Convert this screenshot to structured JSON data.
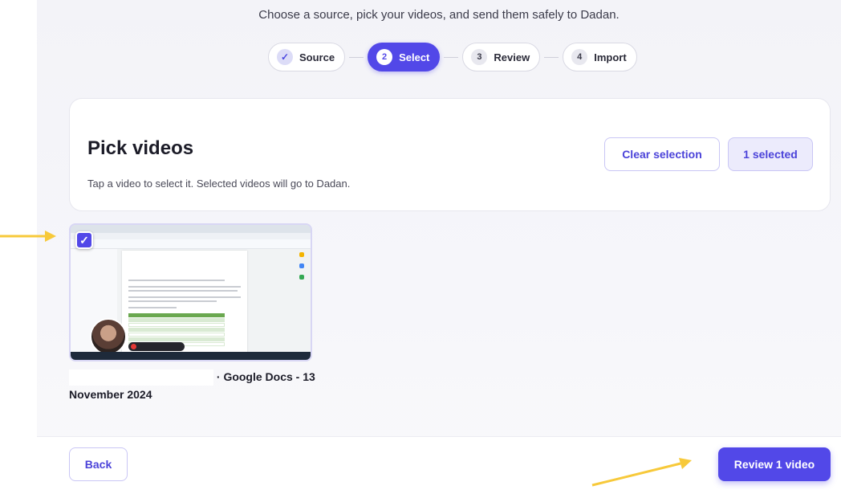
{
  "header": {
    "subtitle": "Choose a source, pick your videos, and send them safely to Dadan."
  },
  "stepper": {
    "steps": [
      {
        "number": "✓",
        "label": "Source",
        "state": "done"
      },
      {
        "number": "2",
        "label": "Select",
        "state": "active"
      },
      {
        "number": "3",
        "label": "Review",
        "state": "upcoming"
      },
      {
        "number": "4",
        "label": "Import",
        "state": "upcoming"
      }
    ]
  },
  "card": {
    "title": "Pick videos",
    "description": "Tap a video to select it. Selected videos will go to Dadan.",
    "clear_label": "Clear selection",
    "selected_label": "1 selected"
  },
  "videos": [
    {
      "title_line1": "· Google Docs - 13",
      "title_line2": "November 2024",
      "selected": true
    }
  ],
  "footer": {
    "back_label": "Back",
    "review_label": "Review 1 video"
  },
  "colors": {
    "accent": "#5248e8",
    "annotation_arrow": "#f7c93a"
  }
}
